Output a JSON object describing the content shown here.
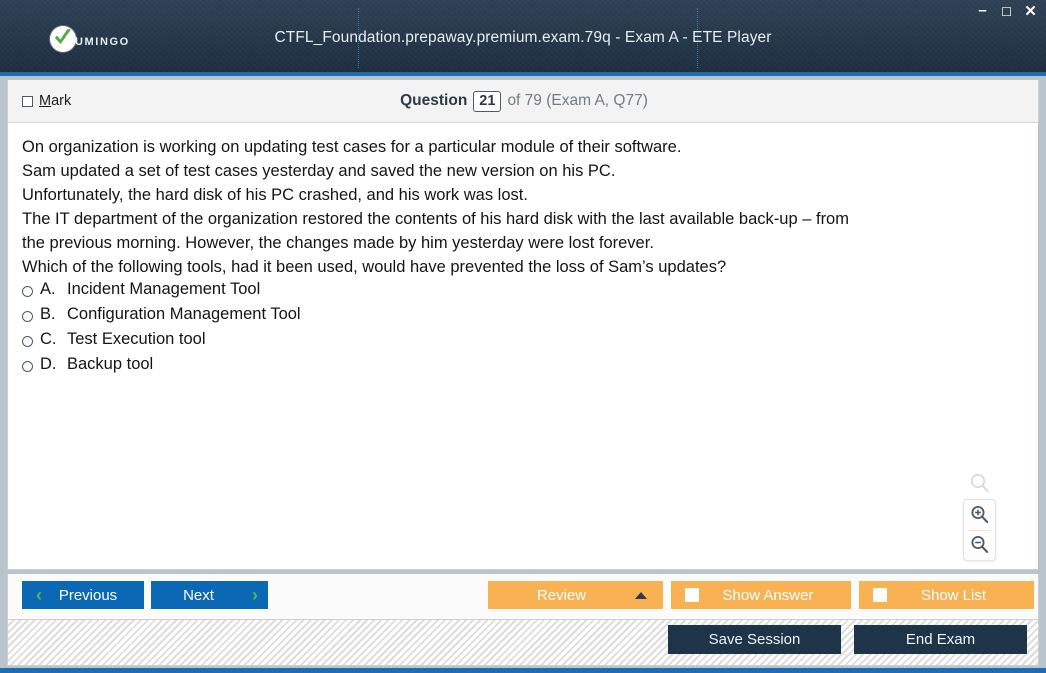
{
  "window": {
    "title": "CTFL_Foundation.prepaway.premium.exam.79q - Exam A - ETE Player",
    "logo_text": "UMINGO",
    "controls": {
      "minimize": "–",
      "maximize": "☐",
      "close": "✕"
    }
  },
  "question_header": {
    "mark_label_accel": "M",
    "mark_label_rest": "ark",
    "question_word": "Question",
    "question_number": "21",
    "question_rest": "of 79 (Exam A, Q77)"
  },
  "question": {
    "lines": [
      "On organization is working on updating test cases for a particular module of their software.",
      "Sam updated a set of test cases yesterday and saved the new version on his PC.",
      "Unfortunately, the hard disk of his PC crashed, and his work was lost.",
      "The IT department of the organization restored the contents of his hard disk with the last available back-up – from",
      "the previous morning. However, the changes made by him yesterday were lost forever.",
      "Which of the following tools, had it been used, would have prevented the loss of Sam’s updates?"
    ],
    "options": [
      {
        "letter": "A.",
        "text": "Incident Management Tool",
        "selected": false
      },
      {
        "letter": "B.",
        "text": "Configuration Management Tool",
        "selected": false
      },
      {
        "letter": "C.",
        "text": "Test Execution tool",
        "selected": false
      },
      {
        "letter": "D.",
        "text": "Backup tool",
        "selected": false
      }
    ]
  },
  "zoom_tools": {
    "ghost_icon": "magnifier-icon",
    "zoom_in_icon": "magnifier-plus-icon",
    "zoom_out_icon": "magnifier-minus-icon"
  },
  "navbar": {
    "previous_label": "Previous",
    "next_label": "Next",
    "previous_chevron": "‹",
    "next_chevron": "›",
    "review_label": "Review",
    "show_answer_label": "Show Answer",
    "show_list_label": "Show List",
    "show_answer_checked": false,
    "show_list_checked": false
  },
  "footer": {
    "save_session_label": "Save Session",
    "end_exam_label": "End Exam"
  },
  "colors": {
    "titlebar_dark": "#26374a",
    "accent_blue": "#1f6cb5",
    "button_blue": "#0b68b5",
    "chevron_green": "#5bb84a",
    "button_orange": "#f9b253",
    "button_dark": "#1e3448",
    "logo_green": "#4caf3e"
  }
}
